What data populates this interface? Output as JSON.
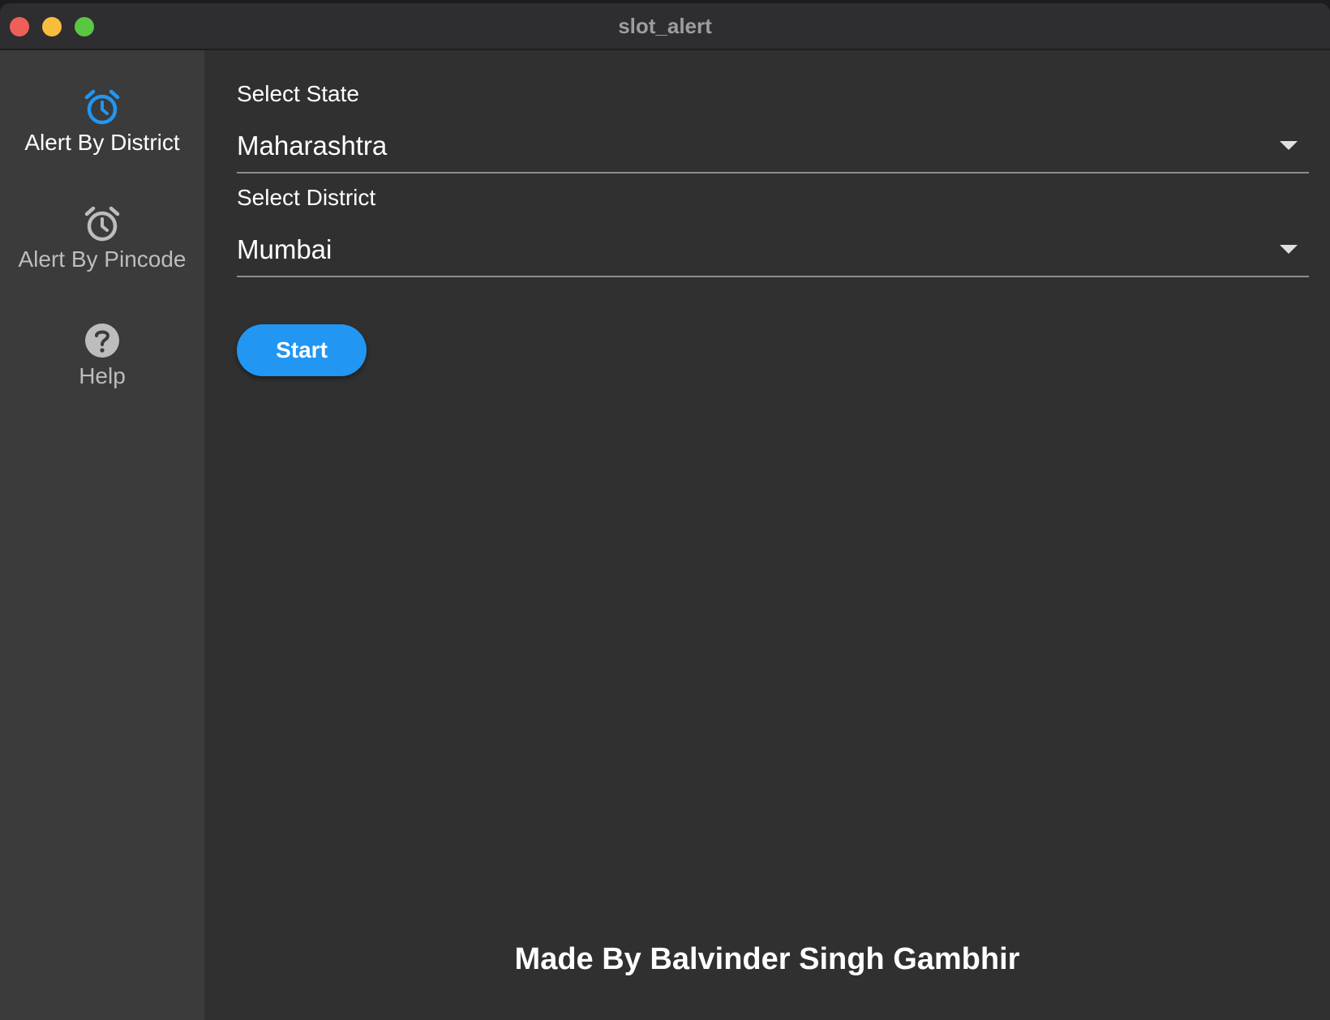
{
  "window": {
    "title": "slot_alert"
  },
  "sidebar": {
    "items": [
      {
        "label": "Alert By District",
        "icon": "alarm-icon",
        "active": true
      },
      {
        "label": "Alert By Pincode",
        "icon": "alarm-icon",
        "active": false
      },
      {
        "label": "Help",
        "icon": "help-circle-icon",
        "active": false
      }
    ]
  },
  "form": {
    "state_label": "Select State",
    "state_value": "Maharashtra",
    "district_label": "Select District",
    "district_value": "Mumbai",
    "start_label": "Start"
  },
  "footer": {
    "credit": "Made By Balvinder Singh Gambhir"
  },
  "colors": {
    "accent": "#2196f3",
    "sidebar_bg": "#3b3b3b",
    "main_bg": "#303030"
  }
}
